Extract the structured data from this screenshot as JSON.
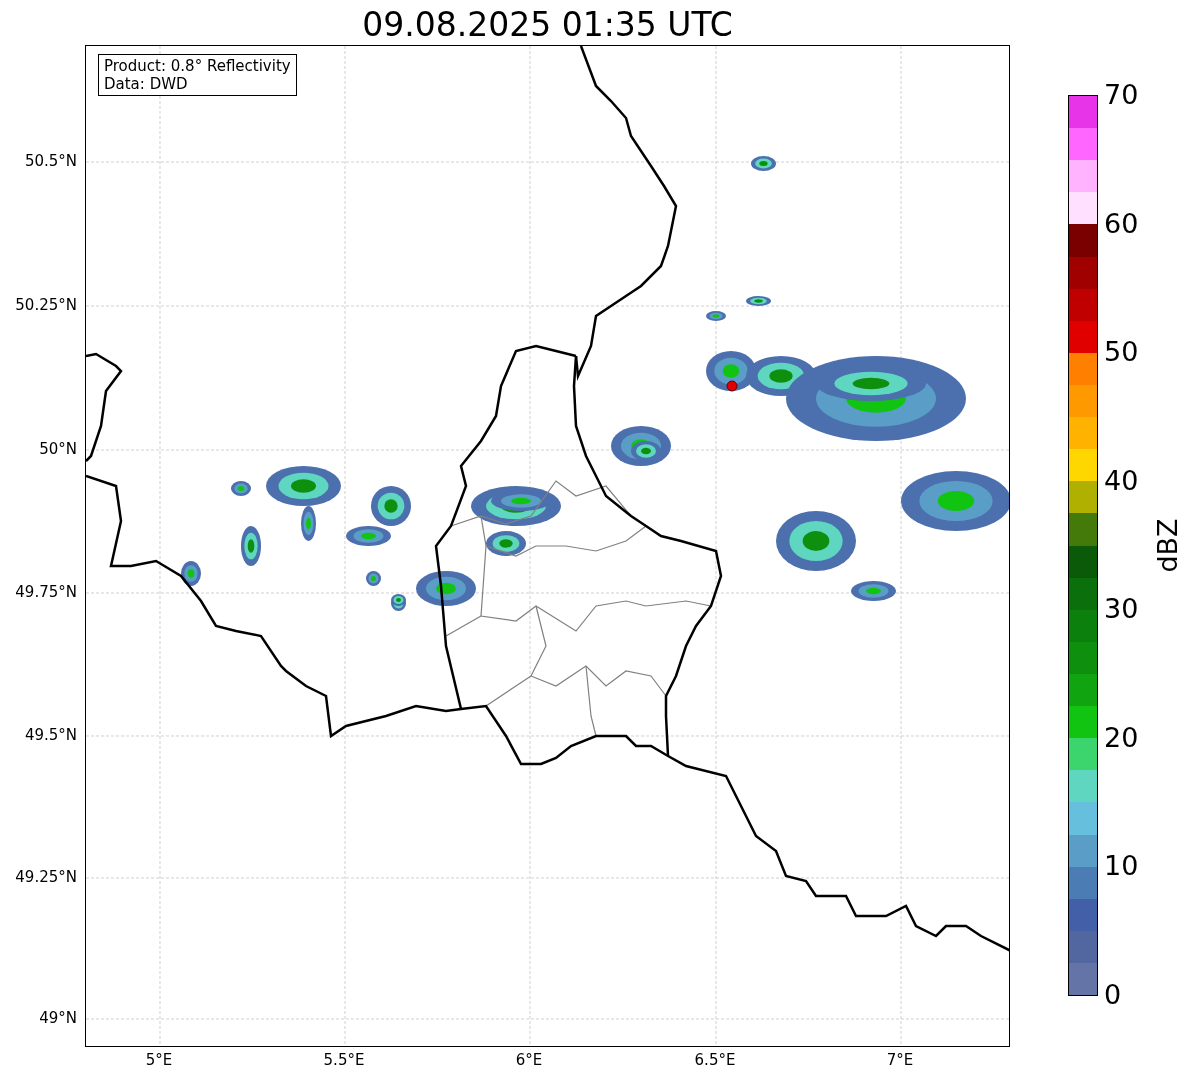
{
  "title": "09.08.2025 01:35 UTC",
  "info_box": [
    "Product: 0.8° Reflectivity",
    "Data: DWD"
  ],
  "map": {
    "lat_ticks": [
      "50.5°N",
      "50.25°N",
      "50°N",
      "49.75°N",
      "49.5°N",
      "49.25°N",
      "49°N"
    ],
    "lon_ticks": [
      "5°E",
      "5.5°E",
      "6°E",
      "6.5°E",
      "7°E"
    ]
  },
  "colorbar": {
    "label": "dBZ",
    "ticks": [
      "70",
      "60",
      "50",
      "40",
      "30",
      "20",
      "10",
      "0"
    ]
  }
}
